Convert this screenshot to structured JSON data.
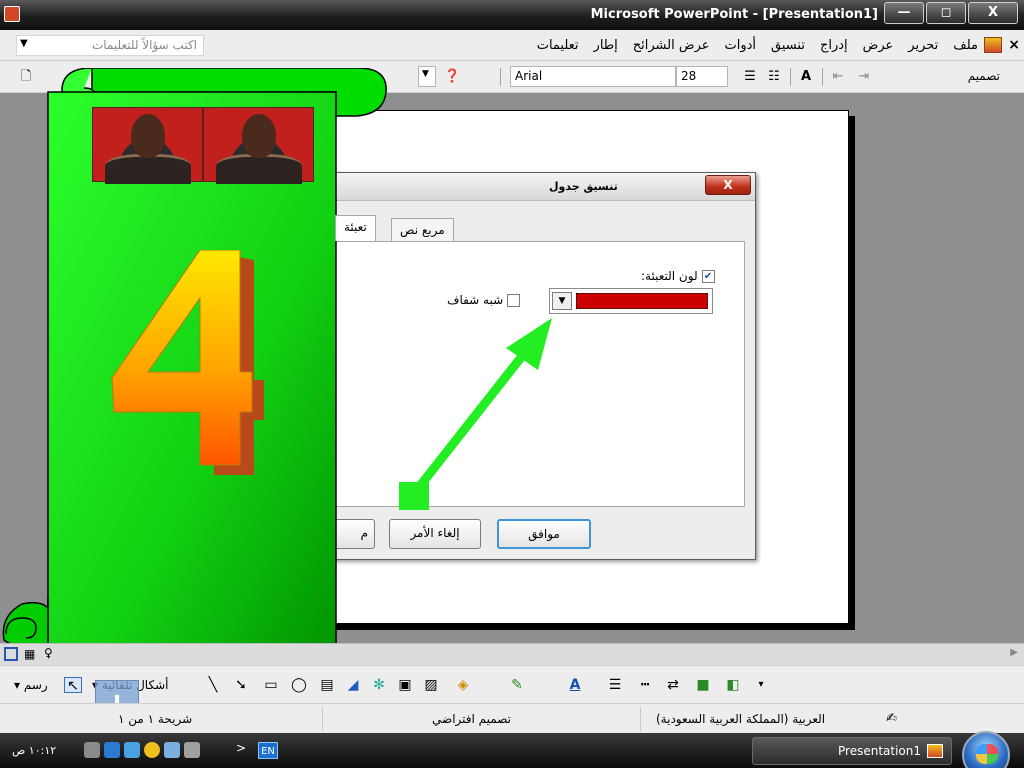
{
  "window": {
    "title": "Microsoft PowerPoint - [Presentation1]",
    "controls": {
      "minimize": "—",
      "maximize": "◻",
      "close": "X"
    }
  },
  "menubar": {
    "close_symbol": "×",
    "items": [
      "ملف",
      "تحرير",
      "عرض",
      "إدراج",
      "تنسيق",
      "أدوات",
      "عرض الشرائح",
      "إطار",
      "تعليمات"
    ],
    "help_placeholder": "اكتب سؤالاً للتعليمات"
  },
  "toolbar": {
    "font_name": "Arial",
    "font_size": "28",
    "design_label": "تصميم"
  },
  "dialog": {
    "title": "تنسيق جدول",
    "close_label": "X",
    "tabs": [
      "تعبئة",
      "مربع نص"
    ],
    "active_tab": "تعبئة",
    "fill_color_label": "لون التعبئة:",
    "fill_color_checked": true,
    "semi_transparent_label": "شبه شفاف",
    "semi_transparent_checked": false,
    "fill_color": "#cc0000",
    "ok_label": "موافق",
    "cancel_label": "إلغاء الأمر",
    "preview_label_fragment": "م"
  },
  "overlay": {
    "arrow_color": "#22ee22",
    "scroll_color": "#00cc00",
    "big_number": "4"
  },
  "drawbar": {
    "draw_label": "رسم",
    "shapes_label": "أشكال تلقائية"
  },
  "statusbar": {
    "slide_info": "شريحة ١ من ١",
    "design_name": "تصميم افتراضي",
    "language": "العربية (المملكة العربية السعودية)"
  },
  "taskbar": {
    "time": "١٠:١٢ ص",
    "language_indicator": "EN",
    "task_label": "Presentation1"
  }
}
